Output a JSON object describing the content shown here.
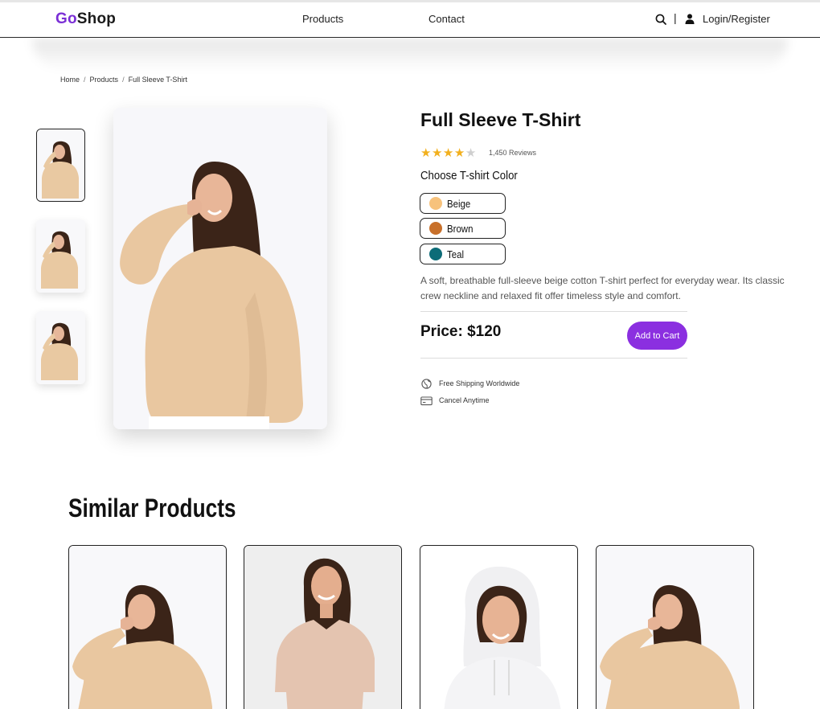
{
  "header": {
    "logo_prefix": "Go",
    "logo_suffix": "Shop",
    "nav": [
      "Products",
      "Contact"
    ],
    "separator": "|",
    "login_label": "Login/Register",
    "icons": [
      "search-icon",
      "user-icon"
    ]
  },
  "breadcrumb": [
    "Home",
    "Products",
    "Full Sleeve T-Shirt"
  ],
  "product": {
    "title": "Full Sleeve T-Shirt",
    "rating": 4,
    "rating_max": 5,
    "reviews": "1,450 Reviews",
    "choose_label": "Choose T-shirt Color",
    "colors": [
      {
        "name": "Beige",
        "hex": "#f7c27c"
      },
      {
        "name": "Brown",
        "hex": "#c8702a"
      },
      {
        "name": "Teal",
        "hex": "#0d6c78"
      }
    ],
    "description": "A soft, breathable full-sleeve beige cotton T-shirt perfect for everyday wear. Its classic crew neckline and relaxed fit offer timeless style and comfort.",
    "price": "Price: $120",
    "cart_label": "Add to Cart",
    "features": [
      {
        "icon": "globe-icon",
        "text": "Free Shipping Worldwide"
      },
      {
        "icon": "card-icon",
        "text": "Cancel Anytime"
      }
    ]
  },
  "similar": {
    "title": "Similar Products"
  },
  "colors": {
    "brand": "#7b2fd6",
    "button": "#8b2fe0",
    "star": "#f2b01e"
  }
}
